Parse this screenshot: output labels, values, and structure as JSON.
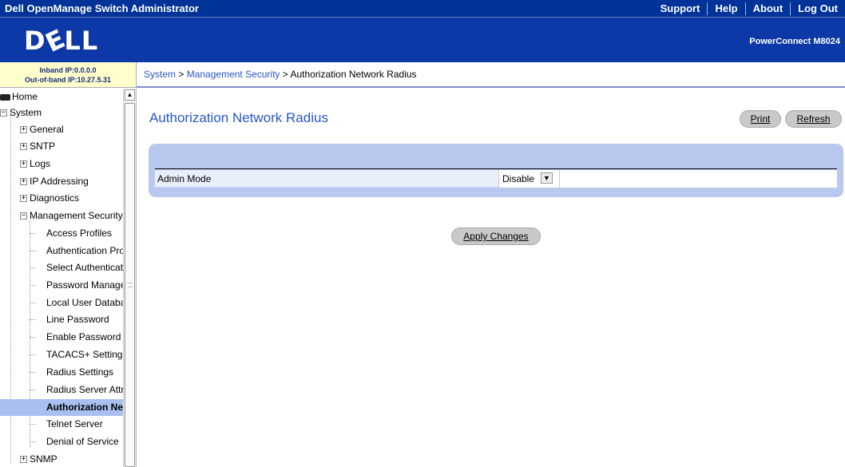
{
  "topbar": {
    "title": "Dell OpenManage Switch Administrator",
    "links": [
      "Support",
      "Help",
      "About",
      "Log Out"
    ]
  },
  "banner": {
    "logo_text": "DELL",
    "model": "PowerConnect M8024"
  },
  "ip_info": {
    "inband": "Inband IP:0.0.0.0",
    "outofband": "Out-of-band IP:10.27.5.31"
  },
  "breadcrumb": {
    "items": [
      "System",
      "Management Security"
    ],
    "separator": " > ",
    "current": "Authorization Network Radius"
  },
  "sidebar": {
    "home": "Home",
    "system": "System",
    "groups": [
      "General",
      "SNTP",
      "Logs",
      "IP Addressing",
      "Diagnostics"
    ],
    "mgmt_security": "Management Security",
    "mgmt_items": [
      "Access Profiles",
      "Authentication Profiles",
      "Select Authentication",
      "Password Management",
      "Local User Database",
      "Line Password",
      "Enable Password",
      "TACACS+ Settings",
      "Radius Settings",
      "Radius Server Attributes",
      "Authorization Network Radius",
      "Telnet Server",
      "Denial of Service"
    ],
    "selected_index": 10,
    "after": [
      "SNMP"
    ]
  },
  "main": {
    "title": "Authorization Network Radius",
    "print_label": "Print",
    "refresh_label": "Refresh",
    "admin_mode_label": "Admin Mode",
    "admin_mode_value": "Disable",
    "apply_label": "Apply Changes"
  },
  "colors": {
    "topbar": "#003399",
    "banner": "#0c38a8",
    "ip_box": "#ffffcc",
    "link": "#2a56c6",
    "panel": "#b9c8ef",
    "selected": "#a8bff0"
  },
  "icons": {
    "home": "home-icon",
    "expand": "plus-icon",
    "collapse": "minus-icon",
    "dropdown": "chevron-down-icon"
  }
}
